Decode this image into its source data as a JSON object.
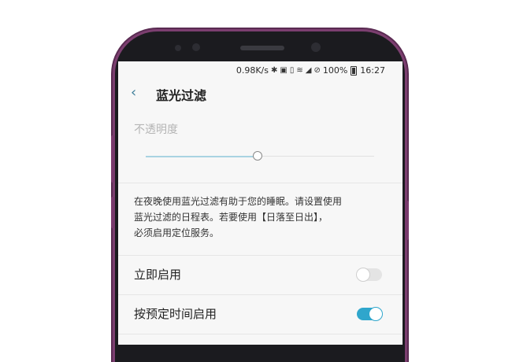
{
  "status_bar": {
    "speed": "0.98K/s",
    "battery": "100%",
    "time": "16:27",
    "icons": [
      "bluetooth-icon",
      "nfc-icon",
      "vibrate-icon",
      "wifi-icon",
      "signal-icon",
      "no-sim-icon",
      "battery-icon"
    ]
  },
  "header": {
    "back_icon": "back-arrow-icon",
    "title": "蓝光过滤"
  },
  "opacity": {
    "label": "不透明度",
    "level": 0.49,
    "accent_color": "#a9d3e2"
  },
  "description": {
    "line1": "在夜晚使用蓝光过滤有助于您的睡眠。请设置使用",
    "line2": "蓝光过滤的日程表。若要使用【日落至日出】，",
    "line3": "必须启用定位服务。"
  },
  "settings": [
    {
      "label": "立即启用",
      "enabled": false
    },
    {
      "label": "按预定时间启用",
      "enabled": true
    }
  ],
  "colors": {
    "toggle_on": "#2fa6cc",
    "toggle_off": "#e4e4e4",
    "phone_frame": "#7c3f70"
  }
}
